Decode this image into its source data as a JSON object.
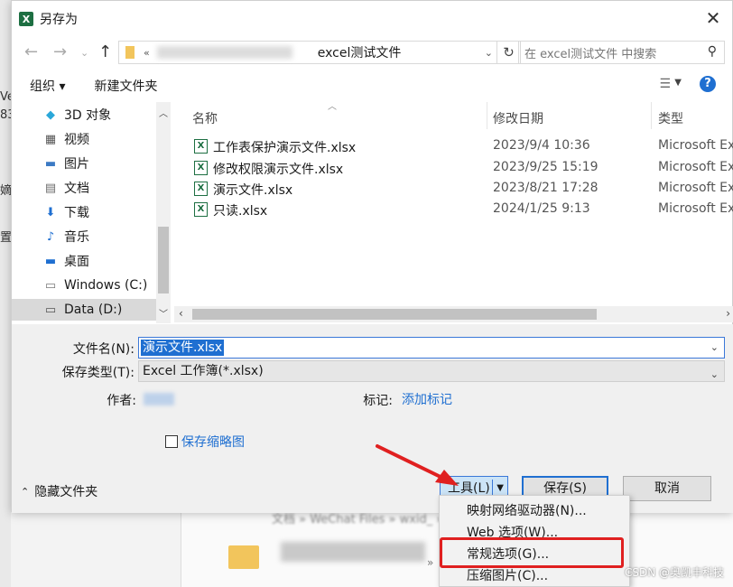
{
  "window": {
    "title": "另存为",
    "app_icon": "excel-icon"
  },
  "address": {
    "prefix": "«",
    "folder": "excel测试文件",
    "search_placeholder": "在 excel测试文件 中搜索"
  },
  "toolbar": {
    "organize": "组织 ▾",
    "new_folder": "新建文件夹"
  },
  "nav": {
    "items": [
      {
        "label": "3D 对象",
        "icon": "cube-icon"
      },
      {
        "label": "视频",
        "icon": "video-icon"
      },
      {
        "label": "图片",
        "icon": "picture-icon"
      },
      {
        "label": "文档",
        "icon": "document-icon"
      },
      {
        "label": "下载",
        "icon": "download-icon"
      },
      {
        "label": "音乐",
        "icon": "music-icon"
      },
      {
        "label": "桌面",
        "icon": "desktop-icon"
      },
      {
        "label": "Windows (C:)",
        "icon": "drive-icon"
      },
      {
        "label": "Data (D:)",
        "icon": "drive-icon",
        "selected": true
      }
    ]
  },
  "columns": {
    "name": "名称",
    "date": "修改日期",
    "type": "类型"
  },
  "files": [
    {
      "name": "工作表保护演示文件.xlsx",
      "date": "2023/9/4 10:36",
      "type": "Microsoft Excel"
    },
    {
      "name": "修改权限演示文件.xlsx",
      "date": "2023/9/25 15:19",
      "type": "Microsoft Excel"
    },
    {
      "name": "演示文件.xlsx",
      "date": "2023/8/21 17:28",
      "type": "Microsoft Excel"
    },
    {
      "name": "只读.xlsx",
      "date": "2024/1/25 9:13",
      "type": "Microsoft Excel"
    }
  ],
  "form": {
    "filename_label": "文件名(N):",
    "filename_value": "演示文件.xlsx",
    "filetype_label": "保存类型(T):",
    "filetype_value": "Excel 工作簿(*.xlsx)",
    "author_label": "作者:",
    "tags_label": "标记:",
    "tags_link": "添加标记",
    "thumbnail_label": "保存缩略图",
    "hide_folders": "隐藏文件夹"
  },
  "buttons": {
    "tools": "工具(L)",
    "save": "保存(S)",
    "cancel": "取消"
  },
  "tools_menu": [
    "映射网络驱动器(N)...",
    "Web 选项(W)...",
    "常规选项(G)...",
    "压缩图片(C)..."
  ],
  "background": {
    "left_fragments": [
      "Ve",
      "83",
      "嫡",
      "置"
    ],
    "path_text": "文档 » WeChat Files » wxid_  » ... » 20..."
  },
  "watermark": "CSDN @奥凯丰科技",
  "colors": {
    "accent": "#1f6fd1",
    "highlight": "#e02020",
    "excel": "#1d6f42"
  }
}
